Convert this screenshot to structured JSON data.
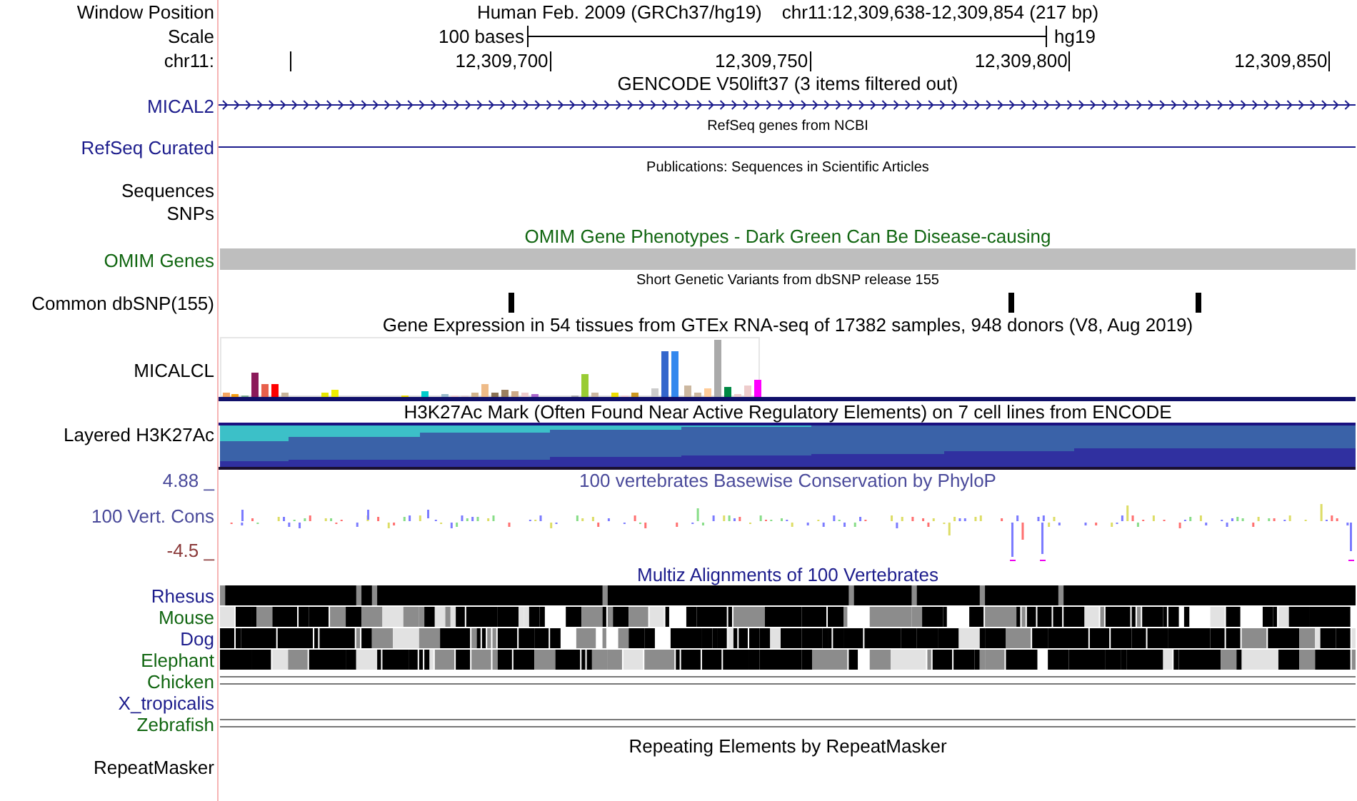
{
  "window_position": {
    "label": "Window Position",
    "assembly": "Human Feb. 2009 (GRCh37/hg19)",
    "region": "chr11:12,309,638-12,309,854 (217 bp)"
  },
  "scale": {
    "label": "Scale",
    "bar_label": "100 bases",
    "assembly": "hg19"
  },
  "ruler": {
    "label": "chr11:",
    "ticks": [
      "12,309,700",
      "12,309,750",
      "12,309,800",
      "12,309,850"
    ]
  },
  "tracks": [
    {
      "kind": "gene",
      "title": "GENCODE V50lift37 (3 items filtered out)",
      "labels": [
        "MICAL2"
      ],
      "color": "#1c1c8c"
    },
    {
      "kind": "line",
      "title": "RefSeq genes from NCBI",
      "labels": [
        "RefSeq Curated"
      ],
      "color": "#1c1c8c"
    },
    {
      "kind": "empty",
      "title": "Publications: Sequences in Scientific Articles",
      "labels": [
        "Sequences",
        "SNPs"
      ],
      "color": "#000000"
    },
    {
      "kind": "bar",
      "title": "OMIM Gene Phenotypes - Dark Green Can Be Disease-causing",
      "labels": [
        "OMIM Genes"
      ],
      "color": "#116611"
    },
    {
      "kind": "snp",
      "title": "Short Genetic Variants from dbSNP release 155",
      "labels": [
        "Common dbSNP(155)"
      ],
      "color": "#000000"
    },
    {
      "kind": "expression",
      "title": "Gene Expression in 54 tissues from GTEx RNA-seq of 17382 samples, 948 donors (V8, Aug 2019)",
      "labels": [
        "MICALCL"
      ],
      "color": "#000000"
    },
    {
      "kind": "layered",
      "title": "H3K27Ac Mark (Often Found Near Active Regulatory Elements) on 7 cell lines from ENCODE",
      "labels": [
        "Layered H3K27Ac"
      ],
      "color": "#000000"
    },
    {
      "kind": "conservation",
      "title": "100 vertebrates Basewise Conservation by PhyloP",
      "labels": [
        "100 Vert. Cons"
      ],
      "color": "#4a4a9a",
      "max": "4.88 _",
      "min": "-4.5 _"
    },
    {
      "kind": "multiz",
      "title": "Multiz Alignments of 100 Vertebrates",
      "color": "#1c1c8c",
      "species": [
        {
          "name": "Rhesus",
          "kind": "blocks",
          "color": "#1c1c8c"
        },
        {
          "name": "Mouse",
          "kind": "blocks",
          "color": "#116611"
        },
        {
          "name": "Dog",
          "kind": "blocks",
          "color": "#1c1c8c"
        },
        {
          "name": "Elephant",
          "kind": "blocks",
          "color": "#116611"
        },
        {
          "name": "Chicken",
          "kind": "lines",
          "color": "#116611"
        },
        {
          "name": "X_tropicalis",
          "kind": "none",
          "color": "#1c1c8c"
        },
        {
          "name": "Zebrafish",
          "kind": "lines",
          "color": "#116611"
        }
      ]
    },
    {
      "kind": "repeat",
      "title": "Repeating Elements by RepeatMasker",
      "labels": [
        "RepeatMasker"
      ],
      "color": "#000000"
    }
  ]
}
